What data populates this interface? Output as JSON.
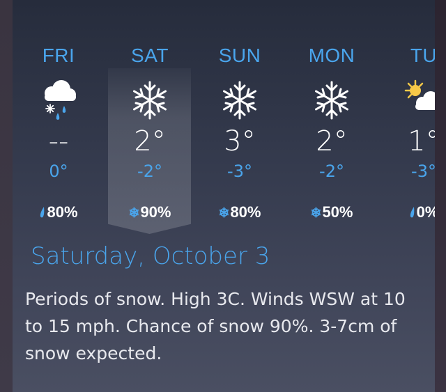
{
  "forecast": {
    "days": [
      {
        "name": "FRI",
        "icon": "snow-rain-cloud-icon",
        "high": "--",
        "low": "0°",
        "precip_icon": "raindrop-icon",
        "precip": "80%"
      },
      {
        "name": "SAT",
        "icon": "snowflake-icon",
        "high": "2°",
        "low": "-2°",
        "precip_icon": "snowflake-icon",
        "precip": "90%",
        "selected": true
      },
      {
        "name": "SUN",
        "icon": "snowflake-icon",
        "high": "3°",
        "low": "-3°",
        "precip_icon": "snowflake-icon",
        "precip": "80%"
      },
      {
        "name": "MON",
        "icon": "snowflake-icon",
        "high": "2°",
        "low": "-2°",
        "precip_icon": "snowflake-icon",
        "precip": "50%"
      },
      {
        "name": "TU",
        "icon": "partly-sunny-icon",
        "high": "1°",
        "low": "-3°",
        "precip_icon": "raindrop-icon",
        "precip": "0%"
      }
    ]
  },
  "detail": {
    "date": "Saturday, October 3",
    "text": "Periods of snow. High 3C. Winds WSW at 10 to 15 mph. Chance of snow 90%. 3-7cm of snow expected."
  },
  "colors": {
    "accent": "#4aa5ec",
    "text": "#ffffff",
    "sun": "#f7c948"
  }
}
